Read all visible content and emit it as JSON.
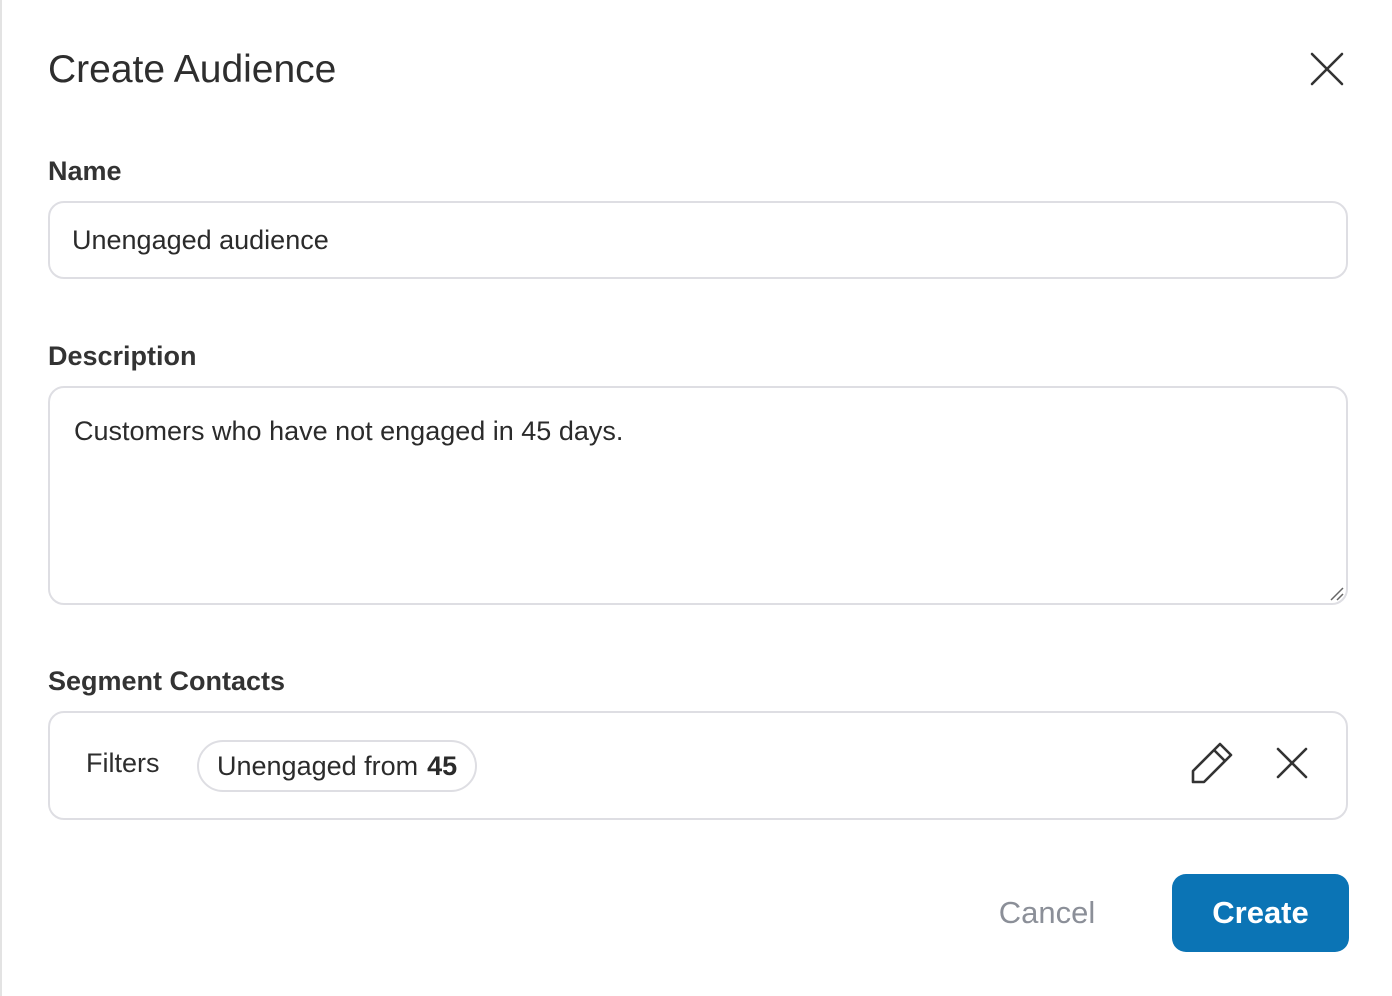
{
  "dialog": {
    "title": "Create Audience"
  },
  "name_field": {
    "label": "Name",
    "value": "Unengaged audience"
  },
  "description_field": {
    "label": "Description",
    "value": "Customers who have not engaged in 45 days."
  },
  "segment": {
    "label": "Segment Contacts",
    "filters_label": "Filters",
    "filter_chip": {
      "text": "Unengaged from",
      "value": "45"
    },
    "icons": {
      "edit": "pencil-icon",
      "remove": "close-icon"
    }
  },
  "actions": {
    "cancel_label": "Cancel",
    "create_label": "Create"
  },
  "colors": {
    "primary": "#0b74b5",
    "border": "#dedee3",
    "muted_text": "#8b8f98"
  }
}
